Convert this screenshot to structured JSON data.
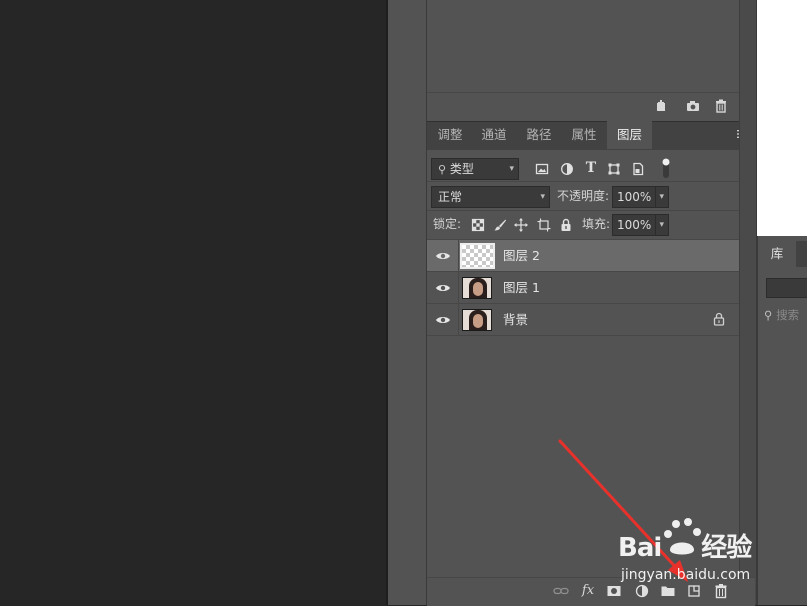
{
  "layers_panel": {
    "tabs": [
      {
        "label": "调整",
        "active": false
      },
      {
        "label": "通道",
        "active": false
      },
      {
        "label": "路径",
        "active": false
      },
      {
        "label": "属性",
        "active": false
      },
      {
        "label": "图层",
        "active": true
      }
    ],
    "filter": {
      "kind_label": "类型",
      "icons": [
        "image-filter-icon",
        "adjustment-filter-icon",
        "type-filter-icon",
        "shape-filter-icon",
        "smart-object-filter-icon",
        "filter-toggle-icon"
      ]
    },
    "blend_mode": "正常",
    "opacity_label": "不透明度:",
    "opacity_value": "100%",
    "lock_label": "锁定:",
    "fill_label": "填充:",
    "fill_value": "100%",
    "layers": [
      {
        "name": "图层 2",
        "selected": true,
        "visible": true,
        "thumbnail": "transparent",
        "locked": false
      },
      {
        "name": "图层 1",
        "selected": false,
        "visible": true,
        "thumbnail": "portrait",
        "locked": false
      },
      {
        "name": "背景",
        "selected": false,
        "visible": true,
        "thumbnail": "portrait",
        "locked": true
      }
    ],
    "bottom_icons": [
      "link-layers-icon",
      "fx-icon",
      "add-mask-icon",
      "adjustment-layer-icon",
      "new-group-icon",
      "new-layer-icon",
      "delete-layer-icon"
    ],
    "fx_label": "fx"
  },
  "top_panel": {
    "icons": [
      "new-snapshot-icon",
      "camera-icon",
      "trash-icon"
    ]
  },
  "library_panel": {
    "tab_label": "库",
    "search_placeholder": "搜索"
  },
  "watermark": {
    "brand": "Bai",
    "brand_suffix": "经验",
    "url": "jingyan.baidu.com"
  },
  "colors": {
    "panel_bg": "#535353",
    "selected_layer": "#6a6a6a",
    "canvas_bg": "#262626",
    "arrow": "#e8312b"
  }
}
